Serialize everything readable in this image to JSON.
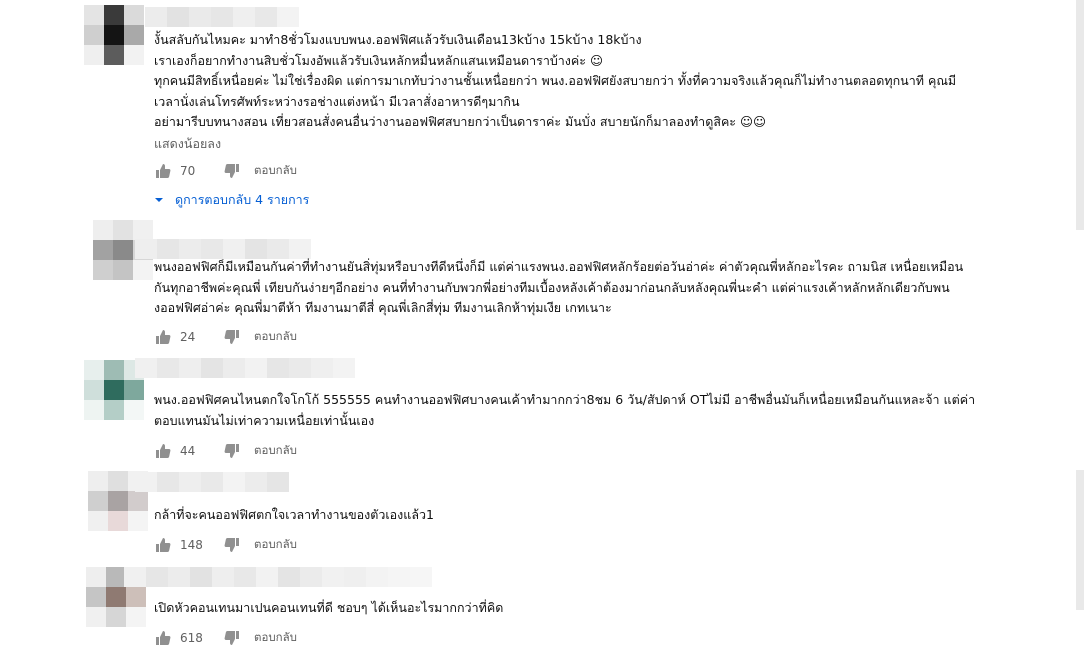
{
  "comments": [
    {
      "lines": [
        "งั้นสลับกันไหมคะ มาทำ8ชั่วโมงแบบพนง.ออฟฟิศแล้วรับเงินเดือน13kบ้าง 15kบ้าง 18kบ้าง",
        "เราเองก็อยากทำงานสิบชั่วโมงอัพแล้วรับเงินหลักหมื่นหลักแสนเหมือนดาราบ้างค่ะ ☺",
        "ทุกคนมีสิทธิ์เหนื่อยค่ะ ไม่ใช่เรื่องผิด แต่การมาเกทับว่างานชั้นเหนื่อยกว่า พนง.ออฟฟิศยังสบายกว่า ทั้งที่ความจริงแล้วคุณก็ไม่ทำงานตลอดทุกนาที คุณมี",
        "เวลานั่งเล่นโทรศัพท์ระหว่างรอช่างแต่งหน้า มีเวลาสั่งอาหารดีๆมากิน",
        "อย่ามารีบบทนางสอน เที่ยวสอนสั่งคนอื่นว่างานออฟฟิศสบายกว่าเป็นดาราค่ะ มันบั่ง สบายนักก็มาลองทำดูสิคะ ☺☺"
      ],
      "show_less": "แสดงน้อยลง",
      "likes": "70",
      "reply_label": "ตอบกลับ",
      "view_replies": "ดูการตอบกลับ 4 รายการ"
    },
    {
      "lines": [
        "พนงออฟฟิศก็มีเหมือนกันค่าที่ทำงานยันสิ่ทุ่มหรือบางทีดีหนึ่งก็มี แต่ค่าแรงพนง.ออฟฟิศหลักร้อยต่อวันอ่าค่ะ ค่าตัวคุณพี่หลักอะไรคะ ถามนิส เหนื่อยเหมือน",
        "กันทุกอาชีพค่ะคุณพี่ เทียบกันง่ายๆอีกอย่าง คนที่ทำงานกับพวกพี่อย่างทีมเบื้องหลังเค้าต้องมาก่อนกลับหลังคุณพี่นะคำ แต่ค่าแรงเค้าหลักหลักเดียวกับพน",
        "งออฟฟิศอ่าค่ะ คุณพี่มาตีห้า ทีมงานมาตีสี่ คุณพี่เลิกสี่ทุ่ม ทีมงานเลิกห้าทุ่มเงีย เกทเนาะ"
      ],
      "likes": "24",
      "reply_label": "ตอบกลับ"
    },
    {
      "lines": [
        "พนง.ออฟฟิศคนไหนตกใจโกโก้ 555555 คนทำงานออฟฟิศบางคนเค้าทำมากกว่า8ชม 6 วัน/สัปดาห์ OTไม่มี  อาชีพอื่นมันก็เหนื่อยเหมือนกันแหละจ้า แต่ค่า",
        "ตอบแทนมันไม่เท่าความเหนื่อยเท่านั้นเอง"
      ],
      "likes": "44",
      "reply_label": "ตอบกลับ"
    },
    {
      "lines": [
        "กล้าที่จะคนออฟฟิศตกใจเวลาทำงานของตัวเองแล้ว1"
      ],
      "likes": "148",
      "reply_label": "ตอบกลับ"
    },
    {
      "lines": [
        "เปิดหัวคอนเทนมาเปนคอนเทนที่ดี ชอบๆ ได้เห็นอะไรมากกว่าที่คิด"
      ],
      "likes": "618",
      "reply_label": "ตอบกลับ"
    }
  ],
  "colors": {
    "text": "#0f0f0f",
    "secondary": "#606060",
    "link": "#065fd4",
    "icon": "#909090"
  },
  "icons": [
    "thumb-up-icon",
    "thumb-down-icon",
    "chevron-down-icon"
  ]
}
